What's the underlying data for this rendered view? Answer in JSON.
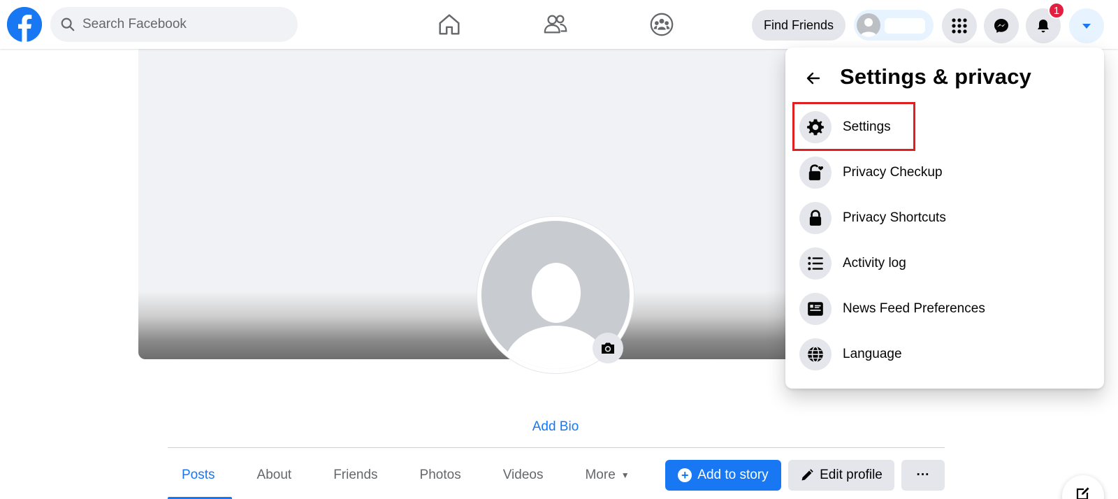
{
  "topbar": {
    "logo_icon": "facebook-logo",
    "search_placeholder": "Search Facebook",
    "nav_icons": [
      "home-icon",
      "friends-icon",
      "groups-icon"
    ],
    "find_friends_label": "Find Friends",
    "notification_count": "1",
    "right_icons": [
      "menu-grid-icon",
      "messenger-icon",
      "bell-icon",
      "account-caret-icon"
    ]
  },
  "profile": {
    "add_bio_label": "Add Bio",
    "tabs": [
      {
        "label": "Posts",
        "active": true
      },
      {
        "label": "About"
      },
      {
        "label": "Friends"
      },
      {
        "label": "Photos"
      },
      {
        "label": "Videos"
      },
      {
        "label": "More"
      }
    ],
    "add_story_label": "Add to story",
    "edit_profile_label": "Edit profile",
    "more_options_label": "···"
  },
  "menu": {
    "title": "Settings & privacy",
    "items": [
      {
        "label": "Settings",
        "icon": "gear-icon"
      },
      {
        "label": "Privacy Checkup",
        "icon": "lock-heart-icon"
      },
      {
        "label": "Privacy Shortcuts",
        "icon": "lock-icon"
      },
      {
        "label": "Activity log",
        "icon": "list-icon"
      },
      {
        "label": "News Feed Preferences",
        "icon": "feed-icon"
      },
      {
        "label": "Language",
        "icon": "globe-icon"
      }
    ]
  },
  "colors": {
    "brand_blue": "#1877f2",
    "badge_red": "#e41e3f",
    "highlight_red": "#e02020",
    "surface_grey": "#e4e6eb"
  }
}
